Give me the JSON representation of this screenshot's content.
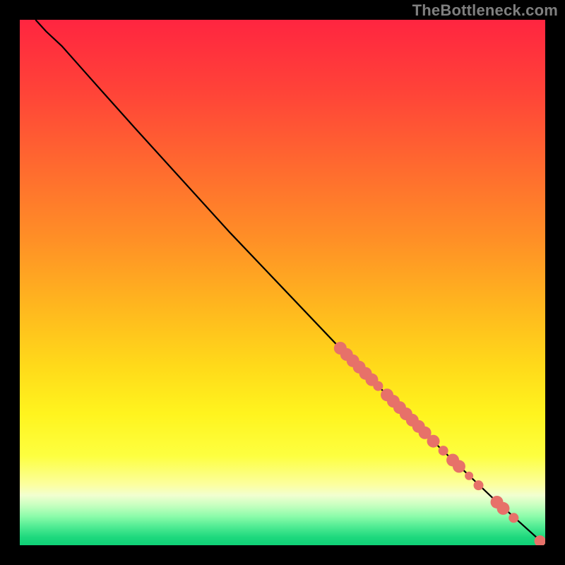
{
  "watermark": {
    "text": "TheBottleneck.com"
  },
  "chart_data": {
    "type": "scatter",
    "title": "",
    "xlabel": "",
    "ylabel": "",
    "xlim": [
      0,
      100
    ],
    "ylim": [
      0,
      100
    ],
    "background_gradient": {
      "direction": "vertical",
      "stops": [
        {
          "offset": 0.0,
          "color": "#ff2540"
        },
        {
          "offset": 0.14,
          "color": "#ff4438"
        },
        {
          "offset": 0.28,
          "color": "#ff6a2f"
        },
        {
          "offset": 0.42,
          "color": "#ff9026"
        },
        {
          "offset": 0.55,
          "color": "#ffb81e"
        },
        {
          "offset": 0.66,
          "color": "#ffda1a"
        },
        {
          "offset": 0.75,
          "color": "#fff41e"
        },
        {
          "offset": 0.83,
          "color": "#fdff40"
        },
        {
          "offset": 0.885,
          "color": "#fcffa0"
        },
        {
          "offset": 0.905,
          "color": "#f2ffd0"
        },
        {
          "offset": 0.925,
          "color": "#c4ffbf"
        },
        {
          "offset": 0.945,
          "color": "#8cfcaa"
        },
        {
          "offset": 0.965,
          "color": "#4feb93"
        },
        {
          "offset": 0.985,
          "color": "#1dd87d"
        },
        {
          "offset": 1.0,
          "color": "#0fd076"
        }
      ]
    },
    "curve": {
      "description": "main diagonal curve",
      "points": [
        {
          "x": 3.0,
          "y": 100.0
        },
        {
          "x": 5.0,
          "y": 97.8
        },
        {
          "x": 8.0,
          "y": 95.0
        },
        {
          "x": 12.0,
          "y": 90.5
        },
        {
          "x": 16.0,
          "y": 86.0
        },
        {
          "x": 22.0,
          "y": 79.3
        },
        {
          "x": 30.0,
          "y": 70.5
        },
        {
          "x": 40.0,
          "y": 59.5
        },
        {
          "x": 50.0,
          "y": 49.0
        },
        {
          "x": 60.0,
          "y": 38.5
        },
        {
          "x": 70.0,
          "y": 28.5
        },
        {
          "x": 80.0,
          "y": 18.5
        },
        {
          "x": 90.0,
          "y": 9.0
        },
        {
          "x": 100.0,
          "y": 0.0
        }
      ]
    },
    "series": [
      {
        "name": "markers",
        "color": "#e77169",
        "points": [
          {
            "x": 61.0,
            "y": 37.5,
            "r": 9
          },
          {
            "x": 62.2,
            "y": 36.3,
            "r": 9
          },
          {
            "x": 63.4,
            "y": 35.1,
            "r": 9
          },
          {
            "x": 64.6,
            "y": 33.9,
            "r": 9
          },
          {
            "x": 65.8,
            "y": 32.7,
            "r": 9
          },
          {
            "x": 67.0,
            "y": 31.5,
            "r": 9
          },
          {
            "x": 68.2,
            "y": 30.3,
            "r": 7
          },
          {
            "x": 69.9,
            "y": 28.6,
            "r": 9
          },
          {
            "x": 71.1,
            "y": 27.4,
            "r": 9
          },
          {
            "x": 72.3,
            "y": 26.2,
            "r": 9
          },
          {
            "x": 73.5,
            "y": 25.0,
            "r": 9
          },
          {
            "x": 74.7,
            "y": 23.8,
            "r": 9
          },
          {
            "x": 75.9,
            "y": 22.6,
            "r": 9
          },
          {
            "x": 77.1,
            "y": 21.4,
            "r": 9
          },
          {
            "x": 78.7,
            "y": 19.8,
            "r": 9
          },
          {
            "x": 80.6,
            "y": 18.0,
            "r": 7
          },
          {
            "x": 82.4,
            "y": 16.2,
            "r": 9
          },
          {
            "x": 83.6,
            "y": 15.0,
            "r": 9
          },
          {
            "x": 85.5,
            "y": 13.2,
            "r": 6
          },
          {
            "x": 87.3,
            "y": 11.4,
            "r": 7
          },
          {
            "x": 90.8,
            "y": 8.2,
            "r": 9
          },
          {
            "x": 92.0,
            "y": 7.0,
            "r": 9
          },
          {
            "x": 94.0,
            "y": 5.2,
            "r": 7
          },
          {
            "x": 99.0,
            "y": 0.8,
            "r": 8
          }
        ]
      }
    ]
  }
}
